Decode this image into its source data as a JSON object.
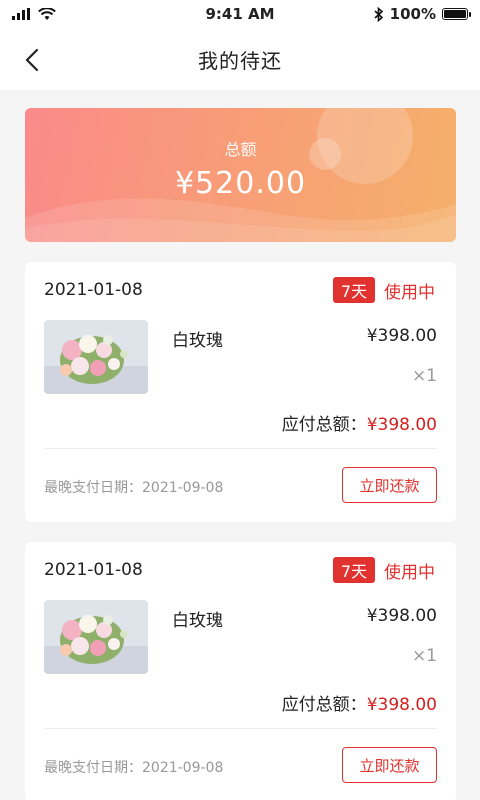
{
  "status_bar": {
    "time": "9:41 AM",
    "battery": "100%"
  },
  "nav": {
    "title": "我的待还"
  },
  "summary": {
    "label": "总额",
    "amount": "¥520.00"
  },
  "colors": {
    "accent": "#e0322f",
    "price_red": "#d61f1f",
    "gradient_start": "#fb8a8a",
    "gradient_end": "#f5b06a"
  },
  "orders": [
    {
      "date": "2021-01-08",
      "days_tag": "7天",
      "status": "使用中",
      "product_name": "白玫瑰",
      "price": "¥398.00",
      "quantity": "×1",
      "total_label": "应付总额：",
      "total_amount": "¥398.00",
      "deadline": "最晚支付日期：2021-09-08",
      "pay_button": "立即还款"
    },
    {
      "date": "2021-01-08",
      "days_tag": "7天",
      "status": "使用中",
      "product_name": "白玫瑰",
      "price": "¥398.00",
      "quantity": "×1",
      "total_label": "应付总额：",
      "total_amount": "¥398.00",
      "deadline": "最晚支付日期：2021-09-08",
      "pay_button": "立即还款"
    }
  ]
}
